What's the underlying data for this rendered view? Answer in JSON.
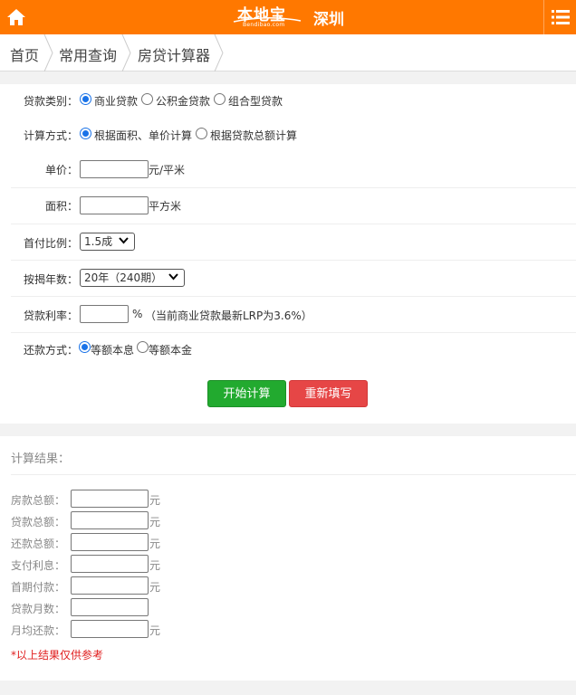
{
  "header": {
    "logo_main": "本地宝",
    "logo_sub": "Bendibao.com",
    "city": "深圳",
    "home_icon": "home-icon",
    "menu_icon": "list-menu-icon",
    "bg_color": "#ff7800"
  },
  "breadcrumb": [
    "首页",
    "常用查询",
    "房贷计算器"
  ],
  "form": {
    "loan_type": {
      "label": "贷款类别：",
      "options": [
        "商业贷款",
        "公积金贷款",
        "组合型贷款"
      ],
      "selected": "商业贷款"
    },
    "calc_method": {
      "label": "计算方式：",
      "options": [
        "根据面积、单价计算",
        "根据贷款总额计算"
      ],
      "selected": "根据面积、单价计算"
    },
    "unit_price": {
      "label": "单价：",
      "value": "",
      "unit": "元/平米"
    },
    "area": {
      "label": "面积：",
      "value": "",
      "unit": "平方米"
    },
    "down_payment": {
      "label": "首付比例：",
      "selected": "1.5成"
    },
    "years": {
      "label": "按揭年数：",
      "selected": "20年（240期）"
    },
    "rate": {
      "label": "贷款利率：",
      "value": "",
      "unit": "%",
      "note": "（当前商业贷款最新LRP为3.6%）"
    },
    "repay_method": {
      "label": "还款方式：",
      "options": [
        "等额本息",
        "等额本金"
      ],
      "selected": "等额本息"
    },
    "buttons": {
      "calculate": "开始计算",
      "reset": "重新填写"
    }
  },
  "result": {
    "title": "计算结果：",
    "fields": [
      {
        "label": "房款总额：",
        "value": "",
        "unit": "元"
      },
      {
        "label": "贷款总额：",
        "value": "",
        "unit": "元"
      },
      {
        "label": "还款总额：",
        "value": "",
        "unit": "元"
      },
      {
        "label": "支付利息：",
        "value": "",
        "unit": "元"
      },
      {
        "label": "首期付款：",
        "value": "",
        "unit": "元"
      },
      {
        "label": "贷款月数：",
        "value": "",
        "unit": ""
      },
      {
        "label": "月均还款：",
        "value": "",
        "unit": "元"
      }
    ],
    "note": "*以上结果仅供参考"
  }
}
